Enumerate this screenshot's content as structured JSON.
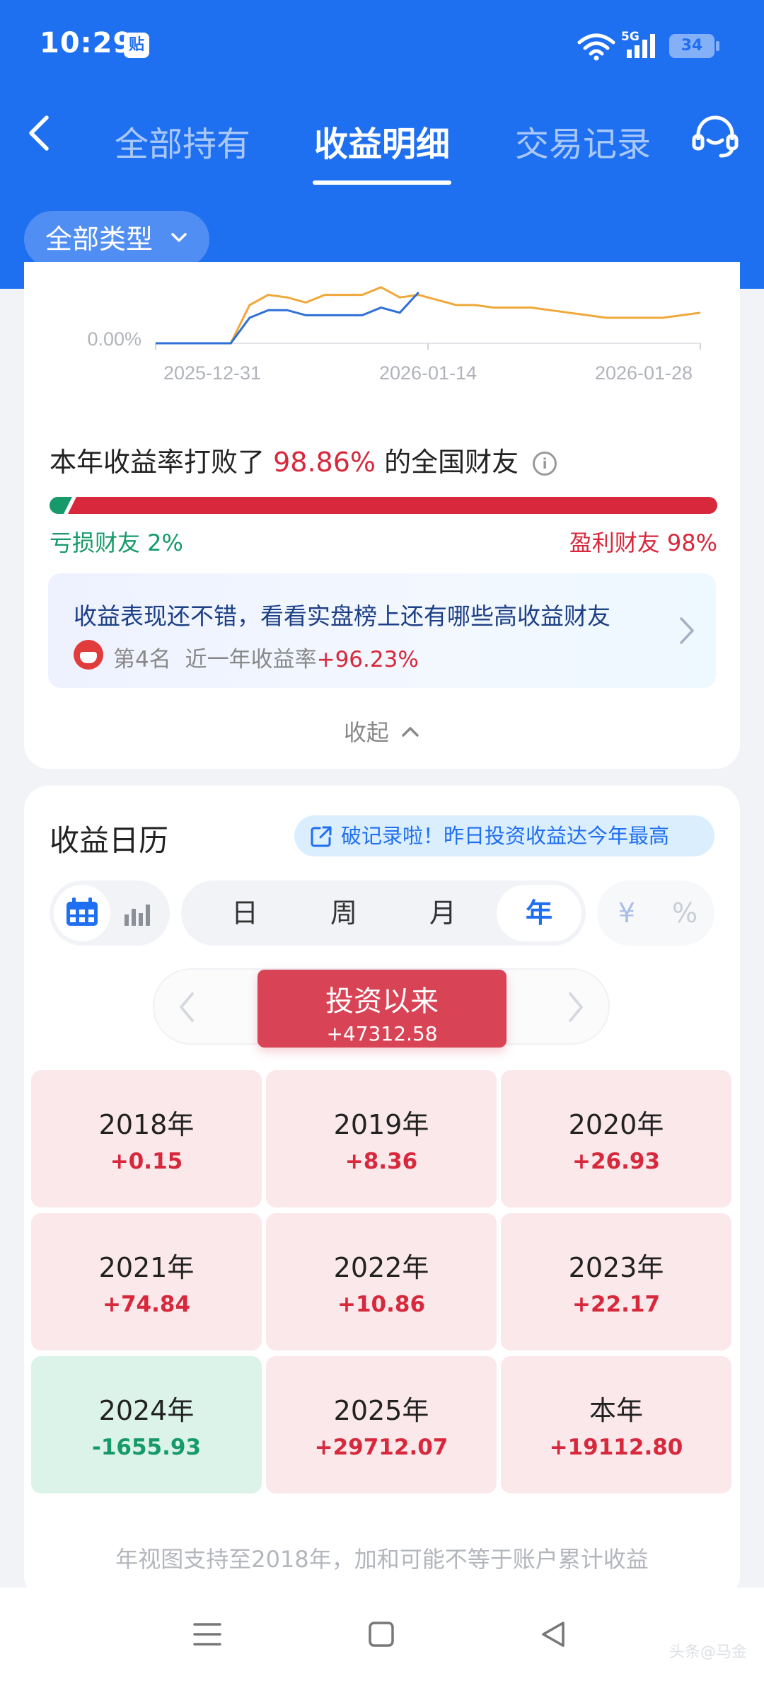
{
  "status": {
    "time": "10:29",
    "badge": "贴",
    "network": "5G",
    "battery": "34"
  },
  "header": {
    "tabs": [
      {
        "label": "全部持有"
      },
      {
        "label": "收益明细"
      },
      {
        "label": "交易记录"
      }
    ],
    "type_filter": "全部类型"
  },
  "chart_data": {
    "type": "line",
    "x_ticks": [
      "2025-12-31",
      "2026-01-14",
      "2026-01-28"
    ],
    "y_ticks": [
      "0.00%"
    ],
    "series": [
      {
        "color": "#2e6fd8",
        "values": [
          0,
          0,
          0,
          0,
          0,
          0.1,
          0.13,
          0.13,
          0.11,
          0.11,
          0.11,
          0.11,
          0.14,
          0.12,
          0.2
        ]
      },
      {
        "color": "#f0a83a",
        "values": [
          0,
          0,
          0,
          0,
          0,
          0.15,
          0.19,
          0.18,
          0.16,
          0.19,
          0.19,
          0.19,
          0.22,
          0.18,
          0.19,
          0.17,
          0.15,
          0.15,
          0.14,
          0.14,
          0.14,
          0.13,
          0.12,
          0.11,
          0.1,
          0.1,
          0.1,
          0.1,
          0.11,
          0.12
        ]
      }
    ]
  },
  "rank_beat": {
    "prefix": "本年收益率打败了",
    "pct": "98.86%",
    "suffix": "的全国财友",
    "lose_label": "亏损财友 2%",
    "win_label": "盈利财友 98%",
    "lose_fraction": 0.02
  },
  "leaderboard": {
    "text": "收益表现还不错，看看实盘榜上还有哪些高收益财友",
    "position": "第4名",
    "metric": "近一年收益率",
    "value": "+96.23%"
  },
  "collapse_label": "收起",
  "calendar": {
    "title": "收益日历",
    "record_badge": "破记录啦！昨日投资收益达今年最高",
    "periods": [
      "日",
      "周",
      "月",
      "年"
    ],
    "active_period": "年",
    "units": [
      "¥",
      "%"
    ],
    "since": {
      "label": "投资以来",
      "value": "+47312.58"
    },
    "years": [
      {
        "year": "2018年",
        "value": "+0.15"
      },
      {
        "year": "2019年",
        "value": "+8.36"
      },
      {
        "year": "2020年",
        "value": "+26.93"
      },
      {
        "year": "2021年",
        "value": "+74.84"
      },
      {
        "year": "2022年",
        "value": "+10.86"
      },
      {
        "year": "2023年",
        "value": "+22.17"
      },
      {
        "year": "2024年",
        "value": "-1655.93"
      },
      {
        "year": "2025年",
        "value": "+29712.07"
      },
      {
        "year": "本年",
        "value": "+19112.80"
      }
    ],
    "footnote": "年视图支持至2018年，加和可能不等于账户累计收益"
  },
  "watermark": "头条@马金"
}
